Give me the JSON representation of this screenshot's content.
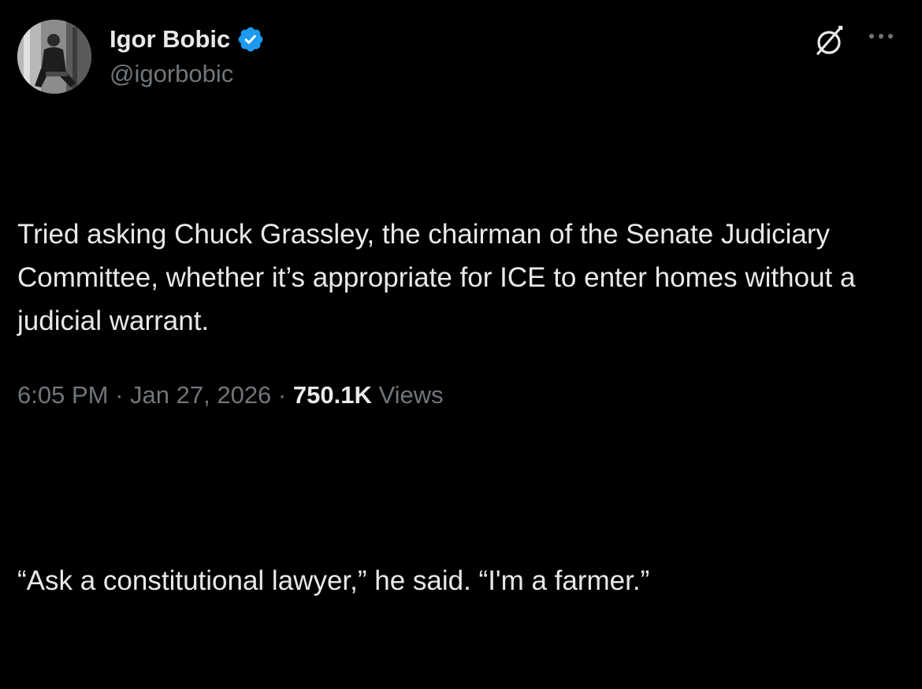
{
  "author": {
    "name": "Igor Bobic",
    "handle": "@igorbobic",
    "verified": true
  },
  "icons": {
    "verified": "verified-badge-icon",
    "grok": "grok-icon",
    "more": "more-options-icon"
  },
  "tweet": {
    "paragraphs": [
      "Tried asking Chuck Grassley, the chairman of the Senate Judiciary Committee, whether it’s appropriate for ICE to enter homes without a judicial warrant.",
      "“Ask a constitutional lawyer,” he said. “I'm a farmer.”"
    ]
  },
  "meta": {
    "time": "6:05 PM",
    "separator": "·",
    "date": "Jan 27, 2026",
    "views_count": "750.1K",
    "views_label": "Views"
  },
  "colors": {
    "background": "#000000",
    "primary_text": "#e7e9ea",
    "secondary_text": "#71767b",
    "verified_blue": "#1d9bf0"
  }
}
